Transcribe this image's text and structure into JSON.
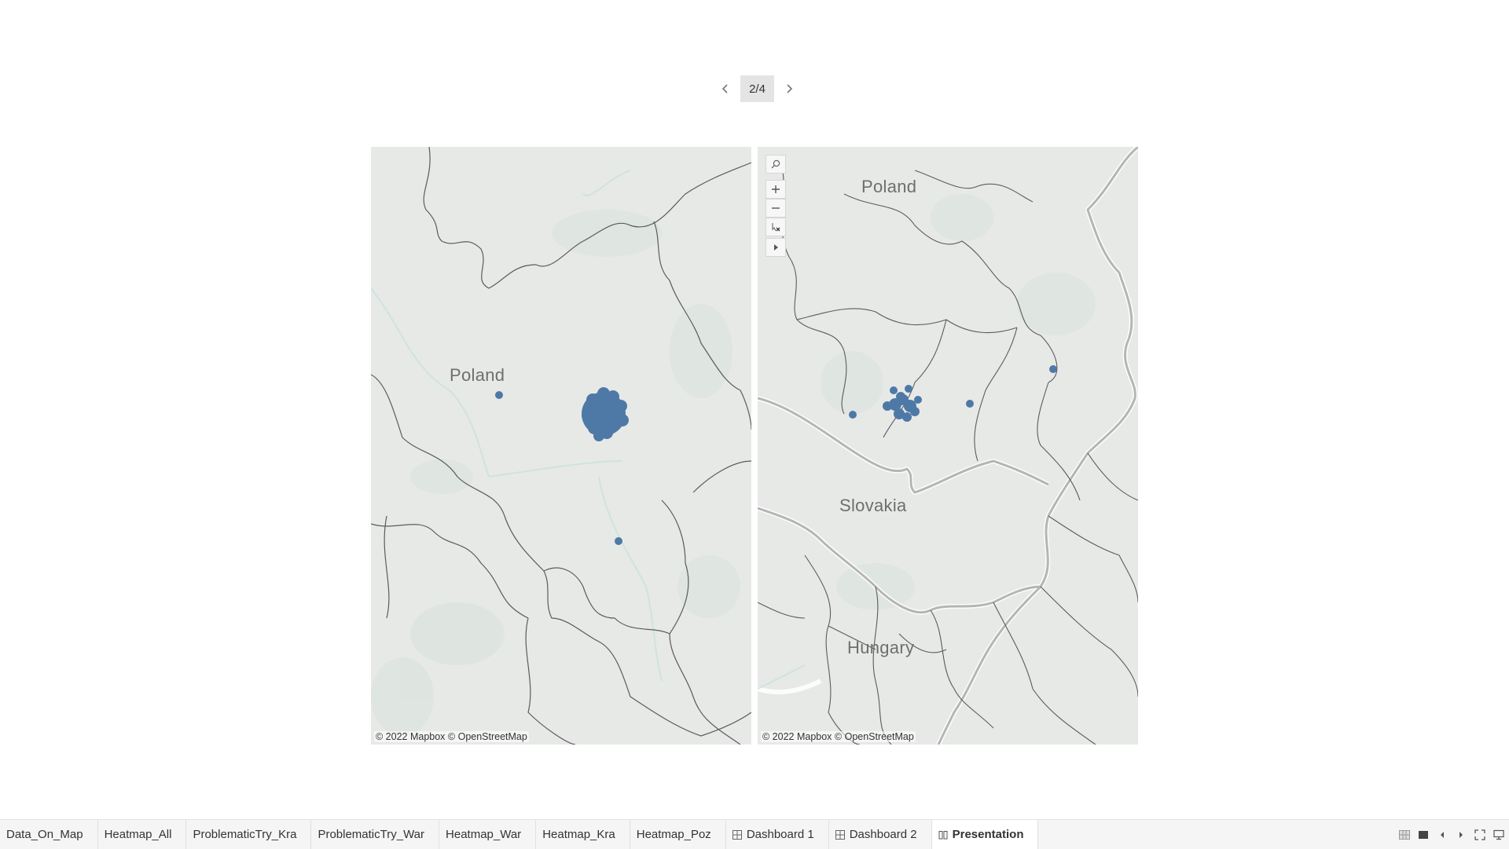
{
  "story_nav": {
    "page_indicator": "2/4",
    "prev_icon": "chevron-left-icon",
    "next_icon": "chevron-right-icon"
  },
  "maps": {
    "left": {
      "labels": {
        "poland": "Poland"
      },
      "attribution": "© 2022 Mapbox © OpenStreetMap"
    },
    "right": {
      "labels": {
        "poland": "Poland",
        "slovakia": "Slovakia",
        "hungary": "Hungary"
      },
      "attribution": "© 2022 Mapbox © OpenStreetMap",
      "toolbar": [
        "search-icon",
        "zoom-in-icon",
        "zoom-out-icon",
        "reset-map-icon",
        "expand-toolbar-icon"
      ]
    },
    "point_color": "#4e79a7"
  },
  "tabs": [
    {
      "label": "Data_On_Map",
      "icon": ""
    },
    {
      "label": "Heatmap_All",
      "icon": ""
    },
    {
      "label": "ProblematicTry_Kra",
      "icon": ""
    },
    {
      "label": "ProblematicTry_War",
      "icon": ""
    },
    {
      "label": "Heatmap_War",
      "icon": ""
    },
    {
      "label": "Heatmap_Kra",
      "icon": ""
    },
    {
      "label": "Heatmap_Poz",
      "icon": ""
    },
    {
      "label": "Dashboard 1",
      "icon": "dashboard-icon"
    },
    {
      "label": "Dashboard 2",
      "icon": "dashboard-icon"
    },
    {
      "label": "Presentation",
      "icon": "story-icon",
      "active": true
    }
  ],
  "tab_controls": [
    "sheet-sorter-icon",
    "filmstrip-icon",
    "prev-sheet-icon",
    "next-sheet-icon",
    "fullscreen-icon",
    "presentation-mode-icon"
  ]
}
